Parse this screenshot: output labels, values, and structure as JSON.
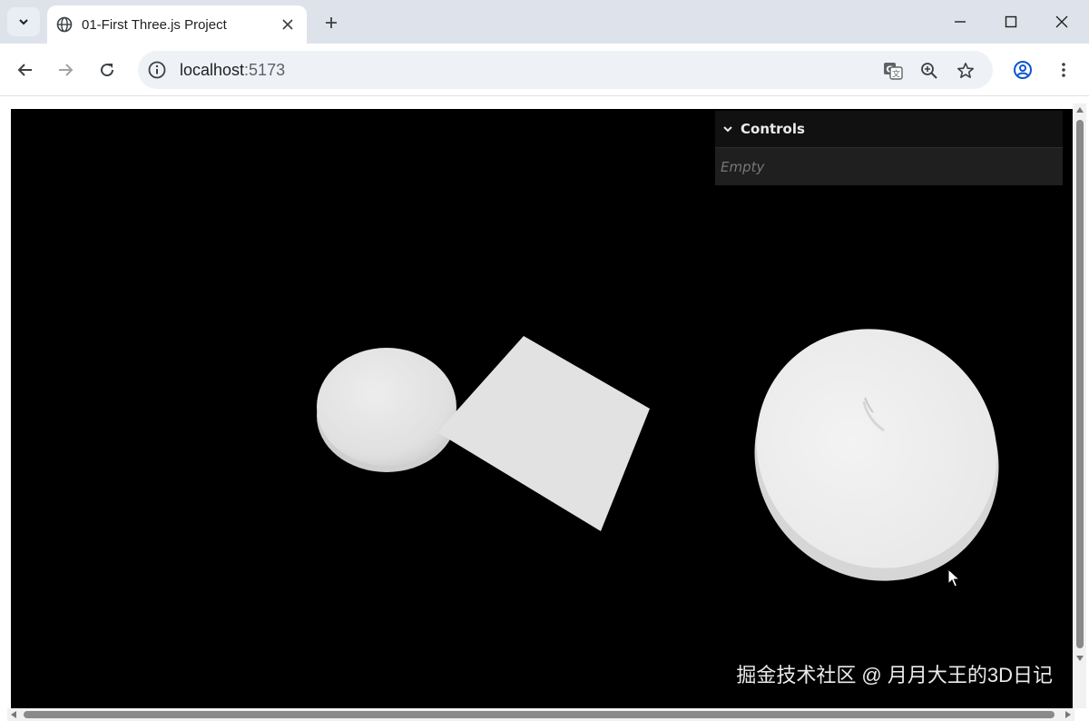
{
  "browser": {
    "tab": {
      "title": "01-First Three.js Project"
    },
    "address": {
      "host": "localhost",
      "port": ":5173"
    }
  },
  "gui": {
    "title": "Controls",
    "empty_text": "Empty"
  },
  "watermark": "掘金技术社区 @ 月月大王的3D日记",
  "icons": {
    "tab_search": "chevron-down-icon",
    "tab_favicon": "globe-icon",
    "tab_close": "close-icon",
    "new_tab": "plus-icon",
    "minimize": "minimize-icon",
    "maximize": "maximize-icon",
    "close_window": "close-icon",
    "back": "back-arrow-icon",
    "forward": "forward-arrow-icon",
    "reload": "reload-icon",
    "site_info": "info-icon",
    "translate": "translate-icon",
    "zoom": "zoom-icon",
    "bookmark": "star-icon",
    "profile": "profile-icon",
    "menu": "kebab-menu-icon"
  },
  "colors": {
    "tabstrip_bg": "#dee3eb",
    "canvas_bg": "#000000",
    "mesh": "#e6e6e6",
    "gui_bg": "#1f1f1f",
    "gui_header_bg": "#111111"
  }
}
